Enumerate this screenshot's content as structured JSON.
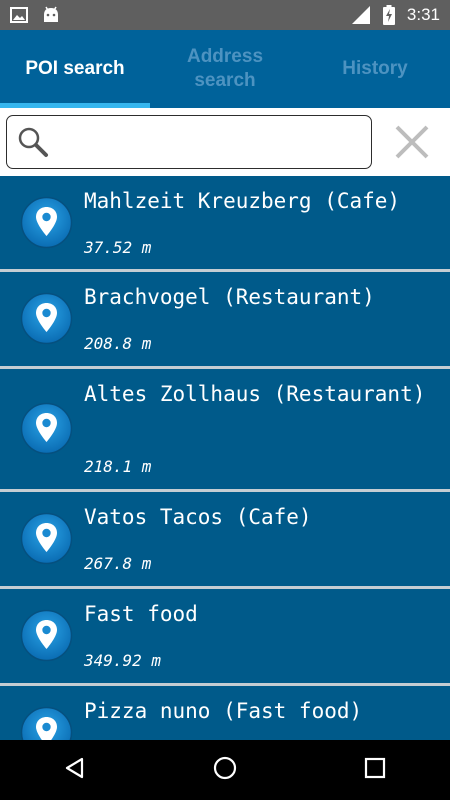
{
  "status_bar": {
    "time": "3:31",
    "icons": [
      "image-icon",
      "android-icon",
      "signal-icon",
      "battery-charging-icon"
    ]
  },
  "tabs": [
    {
      "label": "POI search",
      "active": true
    },
    {
      "label": "Address search",
      "active": false
    },
    {
      "label": "History",
      "active": false
    }
  ],
  "search": {
    "value": "",
    "placeholder": ""
  },
  "poi_list": [
    {
      "name": "Mahlzeit Kreuzberg (Cafe)",
      "distance": "37.52 m"
    },
    {
      "name": "Brachvogel (Restaurant)",
      "distance": "208.8 m"
    },
    {
      "name": "Altes Zollhaus (Restaurant)",
      "distance": "218.1 m"
    },
    {
      "name": "Vatos Tacos (Cafe)",
      "distance": "267.8 m"
    },
    {
      "name": "Fast food",
      "distance": "349.92 m"
    },
    {
      "name": "Pizza nuno (Fast food)",
      "distance": ""
    }
  ],
  "colors": {
    "status_bar": "#5f5f5f",
    "tab_bar": "#00629a",
    "tab_indicator": "#35b6ef",
    "list_background": "#005a8a",
    "divider": "#c4cdd3"
  },
  "nav_bar": {
    "icons": [
      "back-icon",
      "home-icon",
      "recents-icon"
    ]
  }
}
